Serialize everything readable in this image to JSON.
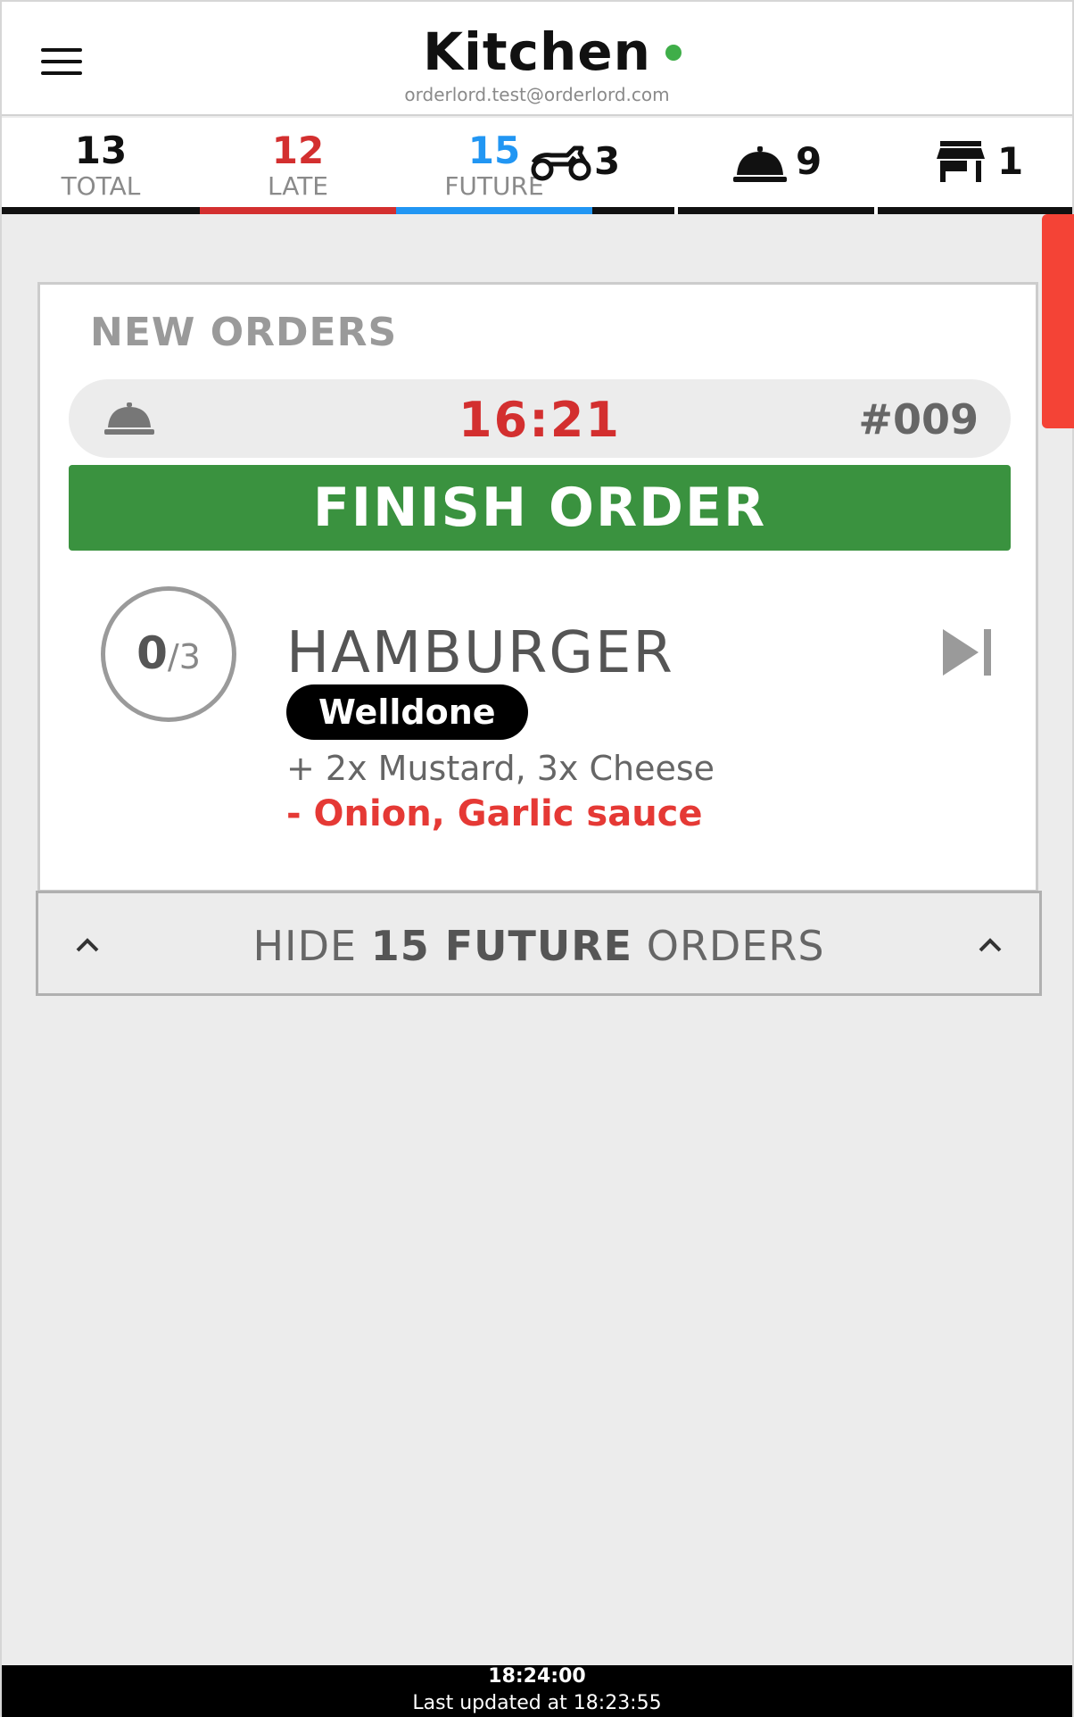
{
  "header": {
    "title": "Kitchen",
    "account": "orderlord.test@orderlord.com",
    "status_color": "#3fae49",
    "menu_icon": "hamburger-menu-icon"
  },
  "stats": {
    "total": {
      "value": "13",
      "label": "TOTAL",
      "color": "#111111"
    },
    "late": {
      "value": "12",
      "label": "LATE",
      "color": "#d32f2f"
    },
    "future": {
      "value": "15",
      "label": "FUTURE",
      "color": "#2196f3"
    },
    "delivery": {
      "icon": "scooter-icon",
      "count": "3"
    },
    "dine_in": {
      "icon": "cloche-icon",
      "count": "9"
    },
    "pickup": {
      "icon": "store-icon",
      "count": "1"
    }
  },
  "new_orders": {
    "section_title": "NEW ORDERS",
    "order": {
      "type_icon": "cloche-icon",
      "time": "16:21",
      "number": "#009",
      "finish_label": "FINISH ORDER",
      "item": {
        "progress_done": "0",
        "progress_sep": "/",
        "progress_total": "3",
        "name": "HAMBURGER",
        "tag": "Welldone",
        "extras": "+ 2x Mustard, 3x Cheese",
        "removals": "- Onion, Garlic sauce"
      }
    }
  },
  "future_toggle": {
    "prefix": "HIDE ",
    "count_text": "15 FUTURE",
    "suffix": " ORDERS"
  },
  "footer": {
    "clock": "18:24:00",
    "last_updated": "Last updated at 18:23:55"
  },
  "colors": {
    "accent_red": "#d32f2f",
    "accent_blue": "#2196f3",
    "finish_green": "#3a923f",
    "scroll_red": "#f44336"
  }
}
